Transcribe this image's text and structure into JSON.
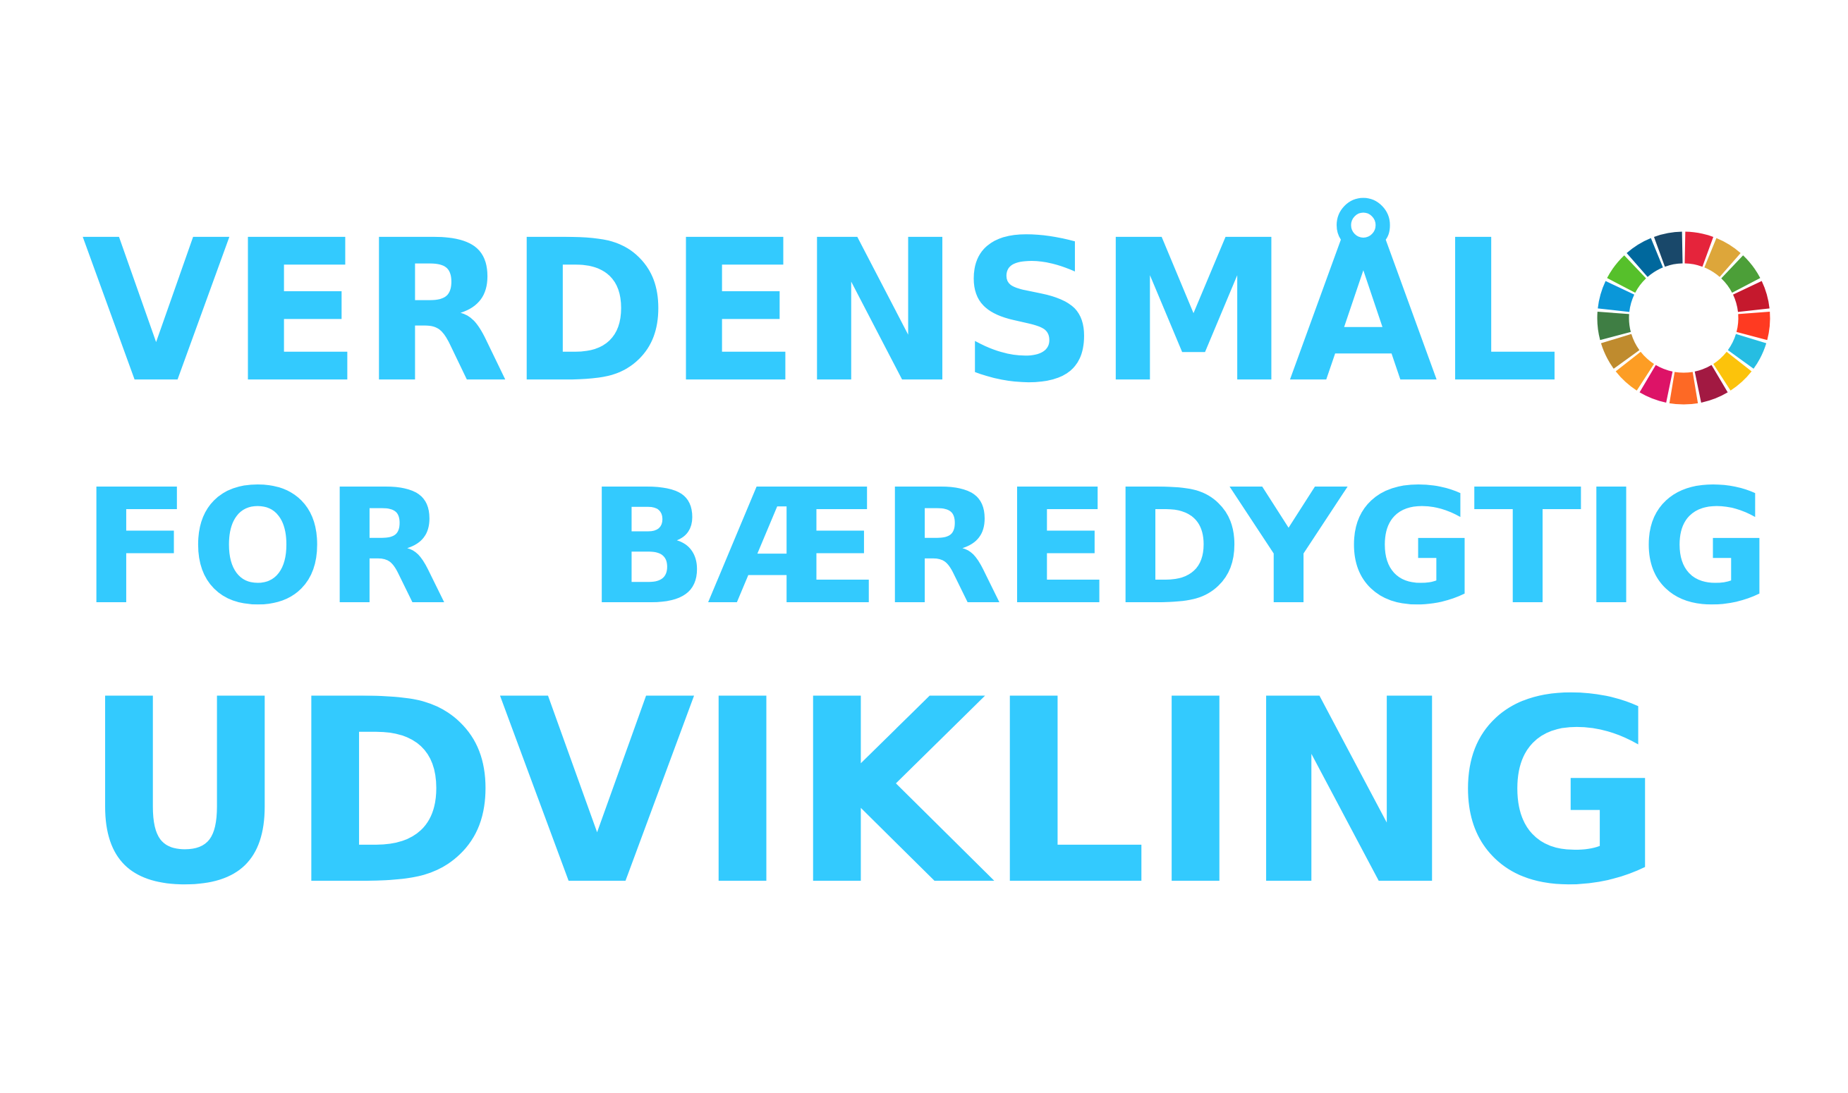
{
  "title": {
    "line1": "VERDENSMÅL",
    "line2": "FOR BÆREDYGTIG",
    "line3": "UDVIKLING"
  },
  "colors": {
    "text": "#33CAFE",
    "background": "#FFFFFF"
  },
  "logo": {
    "icon": "sdg-color-wheel-icon",
    "segment_colors": [
      "#E5243B",
      "#DDA63A",
      "#4C9F38",
      "#C5192D",
      "#FF3A21",
      "#26BDE2",
      "#FCC30B",
      "#A21942",
      "#FD6925",
      "#DD1367",
      "#FD9D24",
      "#BF8B2E",
      "#3F7E44",
      "#0A97D9",
      "#56C02B",
      "#00689D",
      "#19486A"
    ]
  }
}
